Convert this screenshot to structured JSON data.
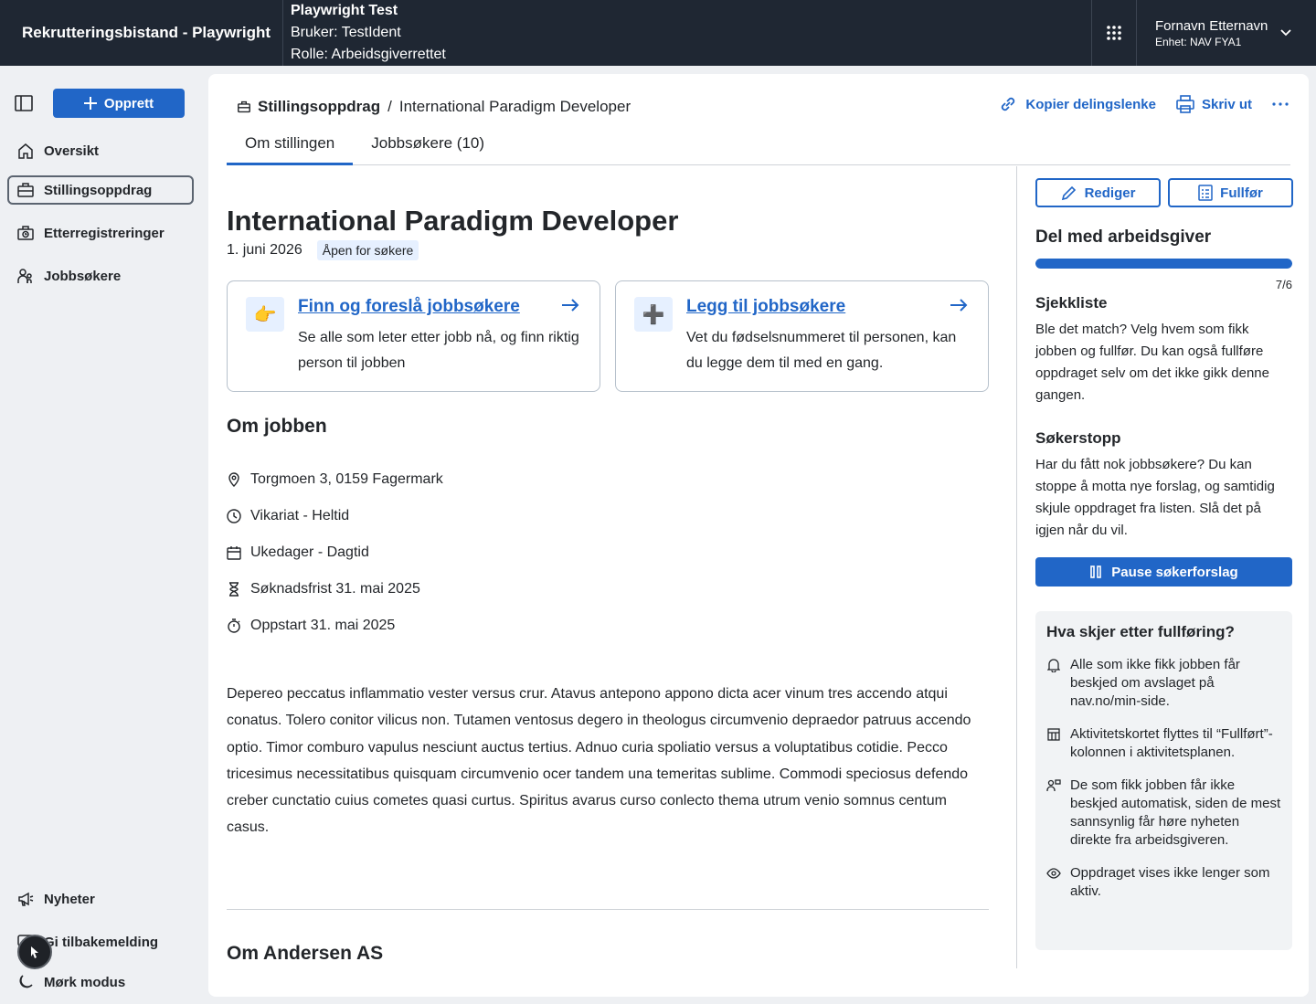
{
  "header": {
    "app_title": "Rekrutteringsbistand - Playwright",
    "env_name": "Playwright Test",
    "user_line": "Bruker: TestIdent",
    "role_line": "Rolle: Arbeidsgiverrettet",
    "user_name": "Fornavn Etternavn",
    "user_unit": "Enhet: NAV FYA1"
  },
  "sidebar": {
    "create_label": "Opprett",
    "items": [
      {
        "label": "Oversikt",
        "icon": "house-icon"
      },
      {
        "label": "Stillingsoppdrag",
        "icon": "briefcase-icon",
        "active": true
      },
      {
        "label": "Etterregistreringer",
        "icon": "briefcase-clock-icon"
      },
      {
        "label": "Jobbsøkere",
        "icon": "people-icon"
      }
    ],
    "bottom_items": [
      {
        "label": "Nyheter",
        "icon": "megaphone-icon"
      },
      {
        "label": "Gi tilbakemelding",
        "icon": "feedback-icon"
      },
      {
        "label": "Mørk modus",
        "icon": "moon-icon"
      }
    ]
  },
  "breadcrumb": {
    "parent": "Stillingsoppdrag",
    "separator": "/",
    "current": "International Paradigm Developer"
  },
  "actions": {
    "copy_link": "Kopier delingslenke",
    "print": "Skriv ut"
  },
  "tabs": [
    {
      "label": "Om stillingen",
      "active": true
    },
    {
      "label": "Jobbsøkere (10)",
      "active": false
    }
  ],
  "job": {
    "title": "International Paradigm Developer",
    "date": "1. juni 2026",
    "status_badge": "Åpen for søkere",
    "cards": [
      {
        "emoji": "👉",
        "title": "Finn og foreslå jobbsøkere",
        "desc": "Se alle som leter etter jobb nå, og finn riktig person til jobben"
      },
      {
        "emoji": "➕",
        "title": "Legg til jobbsøkere",
        "desc": "Vet du fødselsnummeret til personen, kan du legge dem til med en gang."
      }
    ],
    "about_heading": "Om jobben",
    "facts": [
      {
        "icon": "location-pin-icon",
        "text": "Torgmoen 3, 0159 Fagermark"
      },
      {
        "icon": "clock-icon",
        "text": "Vikariat - Heltid"
      },
      {
        "icon": "calendar-icon",
        "text": "Ukedager - Dagtid"
      },
      {
        "icon": "hourglass-icon",
        "text": "Søknadsfrist 31. mai 2025"
      },
      {
        "icon": "stopwatch-icon",
        "text": "Oppstart 31. mai 2025"
      }
    ],
    "description": "Depereo peccatus inflammatio vester versus crur. Atavus antepono appono dicta acer vinum tres accendo atqui conatus. Tolero conitor vilicus non. Tutamen ventosus degero in theologus circumvenio depraedor patruus accendo optio. Timor comburo vapulus nesciunt auctus tertius. Adnuo curia spoliatio versus a voluptatibus cotidie. Pecco tricesimus necessitatibus quisquam circumvenio ocer tandem una temeritas sublime. Commodi speciosus defendo creber cunctatio cuius cometes quasi curtus. Spiritus avarus curso conlecto thema utrum venio somnus centum casus.",
    "company_heading": "Om Andersen AS"
  },
  "panel": {
    "edit_label": "Rediger",
    "finish_label": "Fullfør",
    "share_heading": "Del med arbeidsgiver",
    "progress_text": "7/6",
    "progress_fraction": 1.0,
    "checklist_heading": "Sjekkliste",
    "checklist_text": "Ble det match? Velg hvem som fikk jobben og fullfør. Du kan også fullføre oppdraget selv om det ikke gikk denne gangen.",
    "stop_heading": "Søkerstopp",
    "stop_text": "Har du fått nok jobbsøkere? Du kan stoppe å motta nye forslag, og samtidig skjule oppdraget fra listen. Slå det på igjen når du vil.",
    "pause_label": "Pause søkerforslag",
    "after_heading": "Hva skjer etter fullføring?",
    "after_items": [
      {
        "icon": "bell-icon",
        "text": "Alle som ikke fikk jobben får beskjed om avslaget på nav.no/min-side."
      },
      {
        "icon": "table-icon",
        "text": "Aktivitetskortet flyttes til “Fullført”-kolonnen i aktivitetsplanen."
      },
      {
        "icon": "person-chat-icon",
        "text": "De som fikk jobben får ikke beskjed automatisk, siden de mest sannsynlig får høre nyheten direkte fra arbeidsgiveren."
      },
      {
        "icon": "eye-icon",
        "text": "Oppdraget vises ikke lenger som aktiv."
      }
    ]
  },
  "colors": {
    "accent": "#2166c7",
    "header_bg": "#1f2733",
    "page_bg": "#eef0f3"
  }
}
